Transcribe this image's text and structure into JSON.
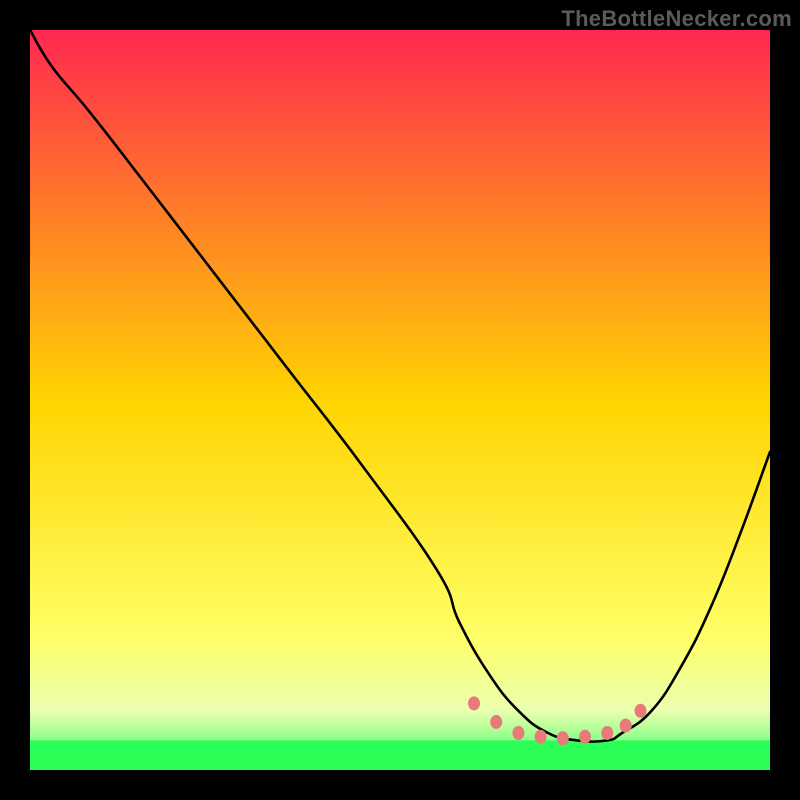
{
  "attribution": "TheBottleNecker.com",
  "chart_data": {
    "type": "line",
    "title": "",
    "xlabel": "",
    "ylabel": "",
    "xlim": [
      0,
      100
    ],
    "ylim": [
      0,
      100
    ],
    "background_gradient": {
      "stops": [
        {
          "pos": 0,
          "color": "#ff2850"
        },
        {
          "pos": 50,
          "color": "#ffd400"
        },
        {
          "pos": 82,
          "color": "#ffff66"
        },
        {
          "pos": 92,
          "color": "#eaffb0"
        },
        {
          "pos": 100,
          "color": "#2eff5e"
        }
      ]
    },
    "series": [
      {
        "name": "bottleneck-curve",
        "color": "#000000",
        "x": [
          0,
          3,
          8,
          15,
          25,
          35,
          45,
          55,
          58,
          62,
          66,
          70,
          74,
          78,
          80,
          84,
          88,
          92,
          96,
          100
        ],
        "y": [
          100,
          95,
          89,
          80,
          67,
          54,
          41,
          27,
          20,
          13,
          8,
          5,
          4,
          4,
          5,
          8,
          14,
          22,
          32,
          43
        ]
      }
    ],
    "markers": [
      {
        "x": 60,
        "y": 9
      },
      {
        "x": 63,
        "y": 6.5
      },
      {
        "x": 66,
        "y": 5
      },
      {
        "x": 69,
        "y": 4.5
      },
      {
        "x": 72,
        "y": 4.3
      },
      {
        "x": 75,
        "y": 4.5
      },
      {
        "x": 78,
        "y": 5
      },
      {
        "x": 80.5,
        "y": 6
      },
      {
        "x": 82.5,
        "y": 8
      }
    ],
    "marker_color": "#e97a7a",
    "green_zone_y": [
      0,
      4
    ]
  }
}
